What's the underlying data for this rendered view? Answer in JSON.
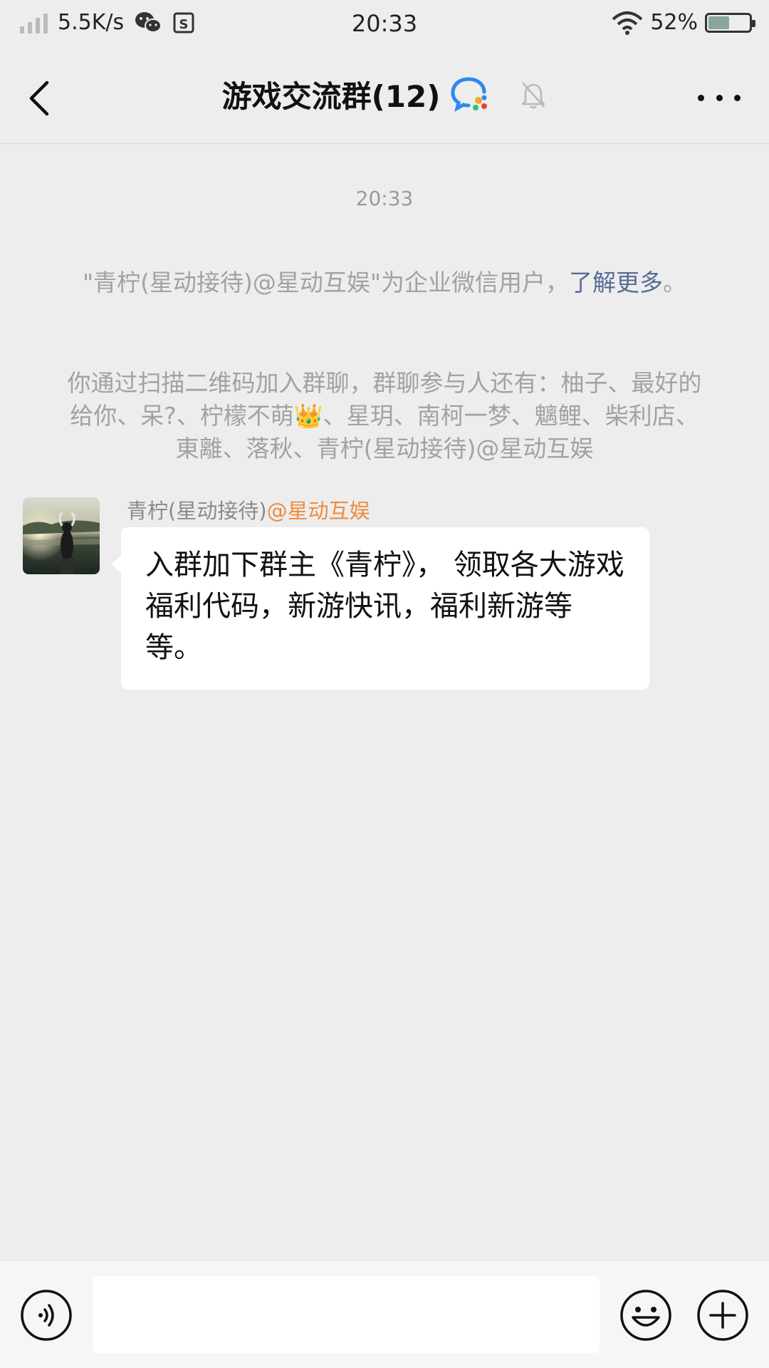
{
  "status_bar": {
    "network_speed": "5.5K/s",
    "time": "20:33",
    "battery": "52%",
    "battery_level": 0.52,
    "icons": [
      "signal-icon",
      "wechat-icon",
      "storage-icon",
      "wifi-icon",
      "battery-icon"
    ]
  },
  "header": {
    "title": "游戏交流群(12)",
    "icons": [
      "back-icon",
      "wework-icon",
      "mute-bell-icon",
      "more-icon"
    ]
  },
  "chat": {
    "timestamp": "20:33",
    "system_messages": [
      {
        "text": "\"青柠(星动接待)@星动互娱\"为企业微信用户，",
        "link": "了解更多",
        "suffix": "。"
      },
      {
        "text": "你通过扫描二维码加入群聊，群聊参与人还有：柚子、最好的给你、呆?、柠檬不萌👑、星玥、南柯一梦、魑鲤、柴利店、東離、落秋、青柠(星动接待)@星动互娱"
      }
    ],
    "messages": [
      {
        "sender_name": "青柠(星动接待)",
        "sender_corp": "@星动互娱",
        "text": "入群加下群主《青柠》， 领取各大游戏福利代码，新游快讯，福利新游等等。"
      }
    ]
  },
  "input_bar": {
    "value": "",
    "icons": [
      "voice-icon",
      "emoji-icon",
      "plus-icon"
    ]
  },
  "colors": {
    "background": "#ededed",
    "bubble": "#ffffff",
    "link": "#586c94",
    "corp_tag": "#f08b3c",
    "system_text": "#a2a2a2"
  }
}
